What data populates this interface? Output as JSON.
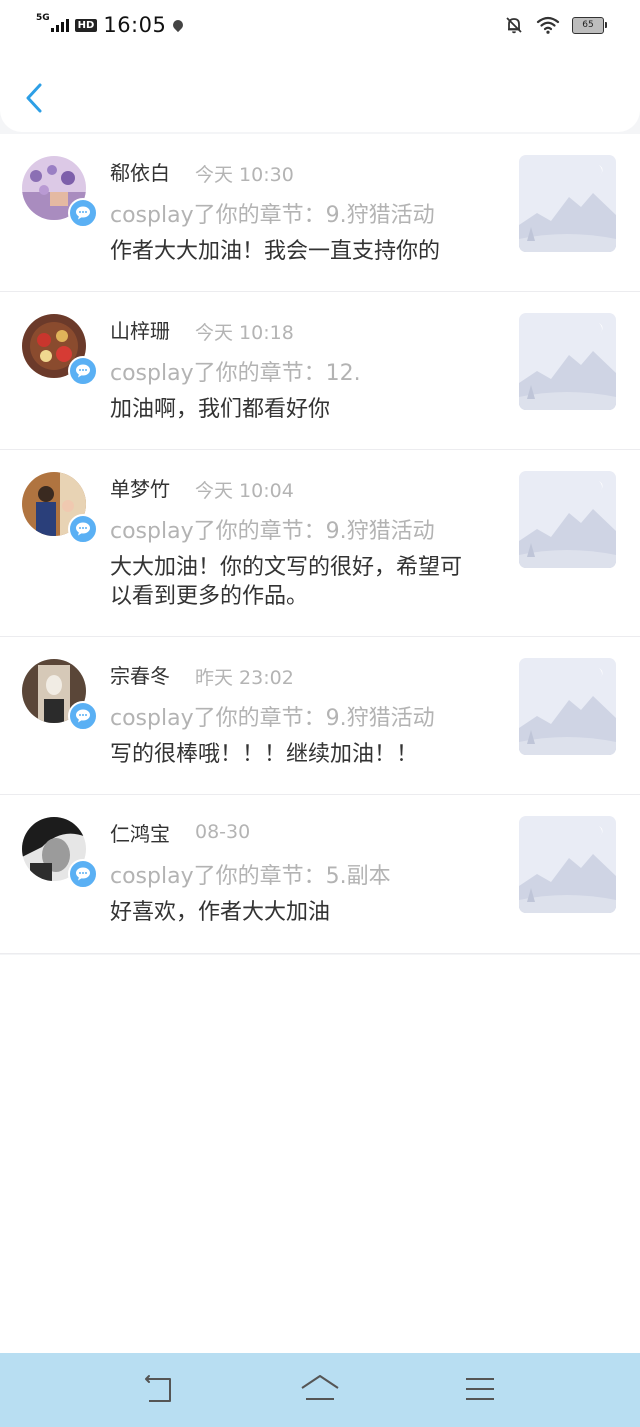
{
  "status_bar": {
    "network": "5G",
    "hd": "HD",
    "time": "16:05",
    "battery": "65"
  },
  "notifications": [
    {
      "user": "郗依白",
      "time": "今天 10:30",
      "chapter": "cosplay了你的章节：9.狩猎活动",
      "comment": "作者大大加油！我会一直支持你的"
    },
    {
      "user": "山梓珊",
      "time": "今天 10:18",
      "chapter": "cosplay了你的章节：12.",
      "comment": "加油啊，我们都看好你"
    },
    {
      "user": "单梦竹",
      "time": "今天 10:04",
      "chapter": "cosplay了你的章节：9.狩猎活动",
      "comment": "大大加油！你的文写的很好，希望可以看到更多的作品。"
    },
    {
      "user": "宗春冬",
      "time": "昨天 23:02",
      "chapter": "cosplay了你的章节：9.狩猎活动",
      "comment": "写的很棒哦！！！继续加油！！"
    },
    {
      "user": "仁鸿宝",
      "time": "08-30",
      "chapter": "cosplay了你的章节：5.副本",
      "comment": "好喜欢，作者大大加油"
    }
  ],
  "colors": {
    "accent": "#2d9fe6",
    "badge": "#5ab0f4",
    "nav_bar": "#b8def2"
  }
}
